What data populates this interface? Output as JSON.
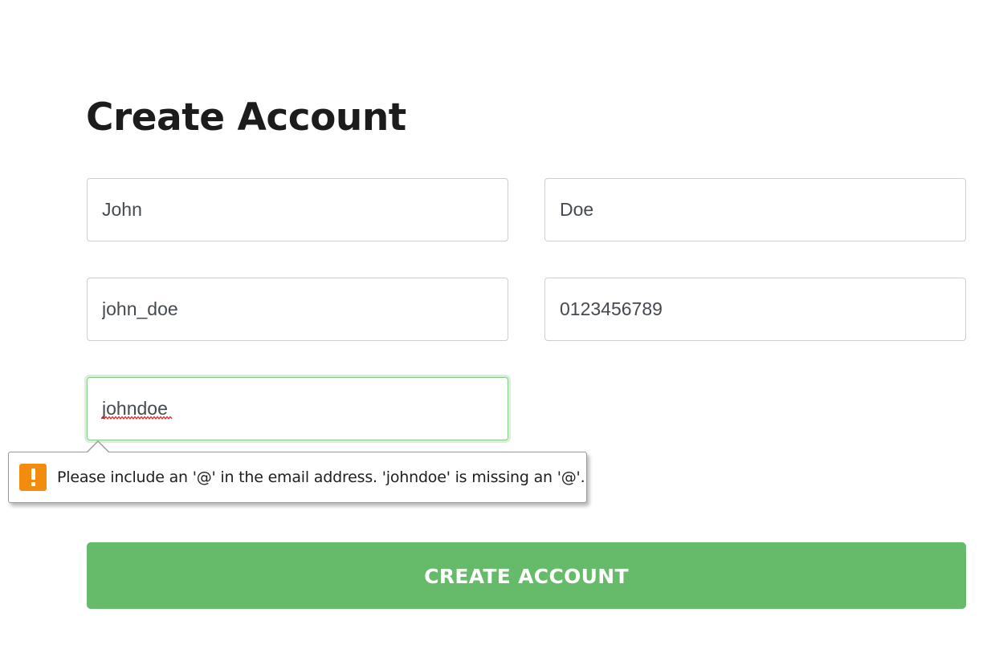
{
  "form": {
    "title": "Create Account",
    "fields": {
      "first_name": {
        "value": "John"
      },
      "last_name": {
        "value": "Doe"
      },
      "username": {
        "value": "john_doe"
      },
      "phone": {
        "value": "0123456789"
      },
      "email": {
        "value": "johndoe"
      }
    },
    "validation": {
      "message": "Please include an '@' in the email address. 'johndoe' is missing an '@'.",
      "icon": "warning-icon"
    },
    "submit_label": "CREATE ACCOUNT"
  },
  "colors": {
    "primary_button": "#66bb6a",
    "focus_ring": "#86c98a",
    "warning_icon": "#f28c0f",
    "title_text": "#1c1c1c",
    "input_text": "#444a4f"
  }
}
